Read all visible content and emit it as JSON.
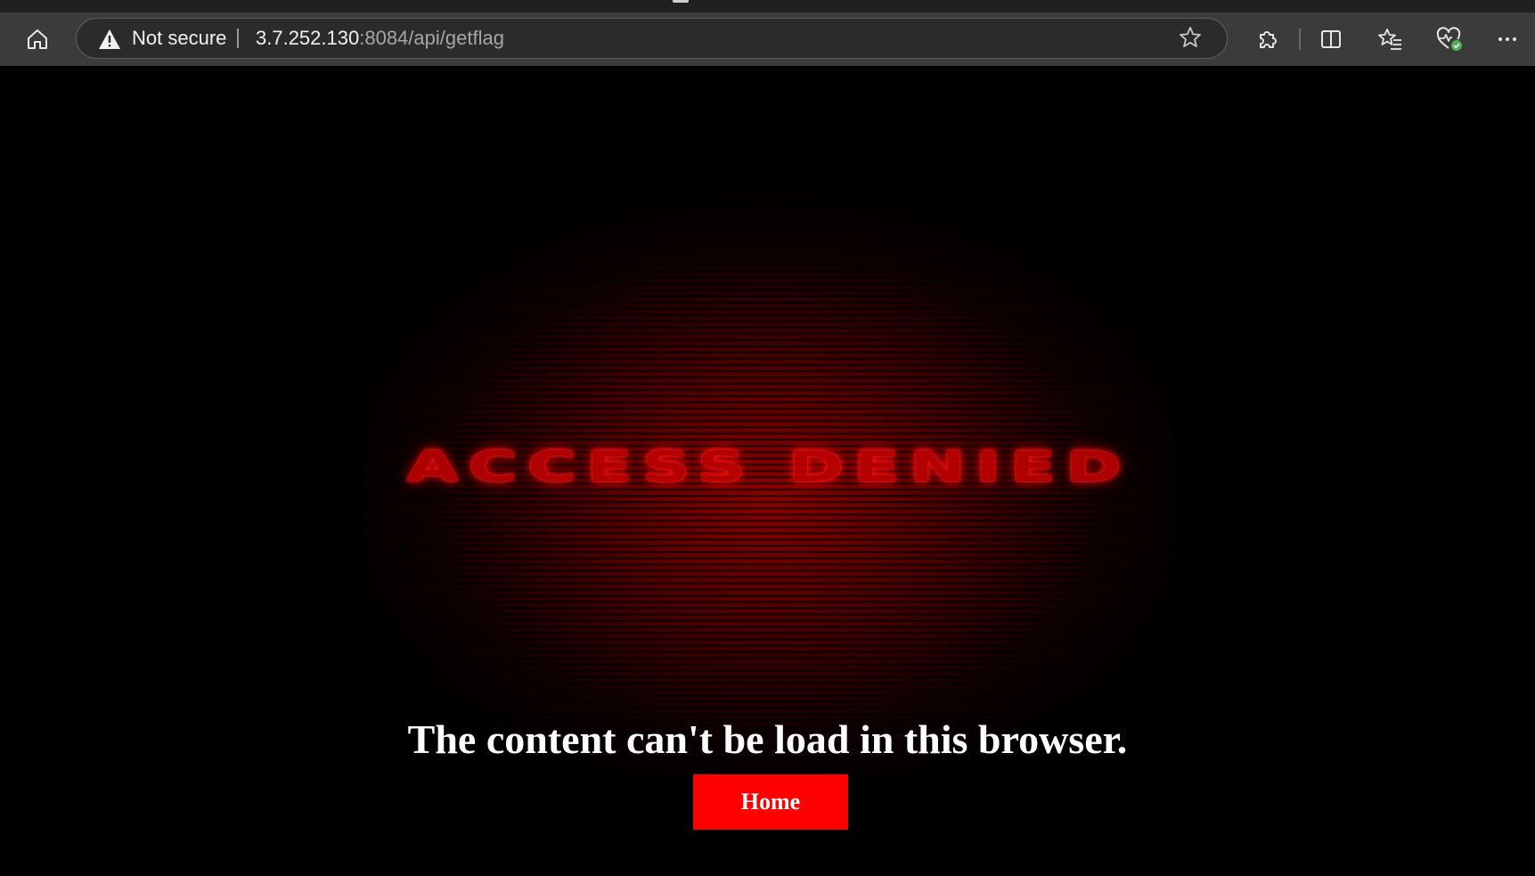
{
  "browser": {
    "security_label": "Not secure",
    "url_host": "3.7.252.130",
    "url_path": ":8084/api/getflag",
    "icons": {
      "home": "home-icon",
      "warning": "warning-icon",
      "favorite": "star-icon",
      "extensions": "puzzle-icon",
      "split_screen": "split-screen-icon",
      "favorites": "favorites-icon",
      "performance": "heart-health-icon",
      "more": "more-icon"
    },
    "status_color": "#4caf50"
  },
  "page": {
    "hero_title": "ACCESS DENIED",
    "message": "The content can't be load in this browser.",
    "home_button_label": "Home",
    "accent_color": "#ff0000"
  }
}
